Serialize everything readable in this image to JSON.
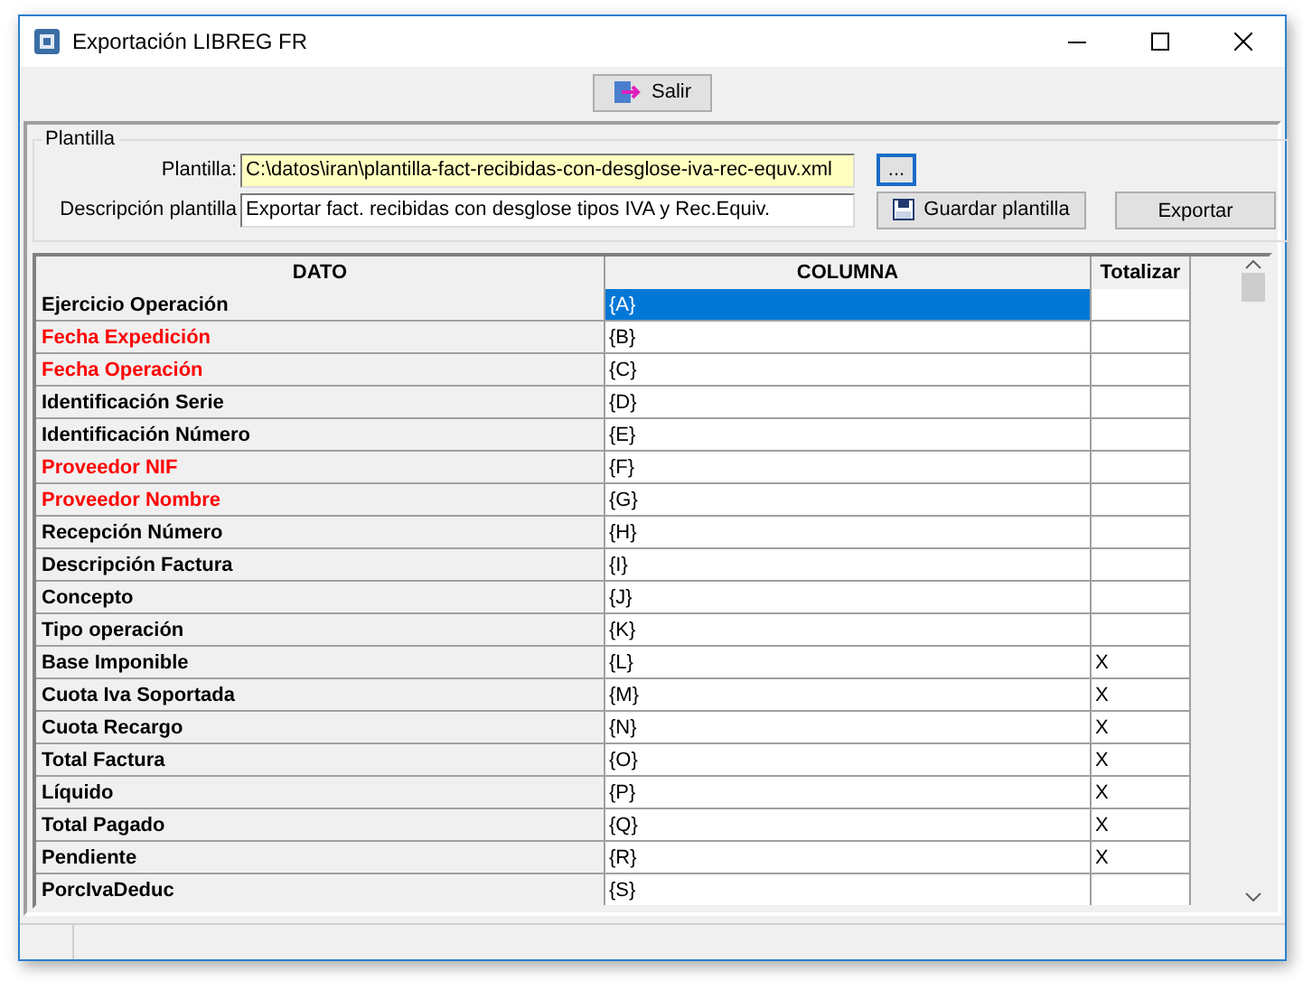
{
  "window": {
    "title": "Exportación LIBREG FR"
  },
  "toolbar": {
    "exit_button": "Salir"
  },
  "group": {
    "title": "Plantilla",
    "template_label": "Plantilla:",
    "template_value": "C:\\datos\\iran\\plantilla-fact-recibidas-con-desglose-iva-rec-equv.xml",
    "browse_button": "...",
    "description_label": "Descripción plantilla",
    "description_value": "Exportar fact. recibidas con desglose tipos IVA y Rec.Equiv.",
    "save_button": "Guardar plantilla",
    "export_button": "Exportar"
  },
  "table": {
    "columns": [
      "DATO",
      "COLUMNA",
      "Totalizar"
    ],
    "rows": [
      {
        "dato": "Ejercicio Operación",
        "columna": "{A}",
        "required": false,
        "selected": true
      },
      {
        "dato": "Fecha Expedición",
        "columna": "{B}",
        "required": true,
        "selected": false
      },
      {
        "dato": "Fecha Operación",
        "columna": "{C}",
        "required": true,
        "selected": false
      },
      {
        "dato": "Identificación Serie",
        "columna": "{D}",
        "required": false,
        "selected": false
      },
      {
        "dato": "Identificación Número",
        "columna": "{E}",
        "required": false,
        "selected": false
      },
      {
        "dato": "Proveedor NIF",
        "columna": "{F}",
        "required": true,
        "selected": false
      },
      {
        "dato": "Proveedor Nombre",
        "columna": "{G}",
        "required": true,
        "selected": false
      },
      {
        "dato": "Recepción Número",
        "columna": "{H}",
        "required": false,
        "selected": false
      },
      {
        "dato": "Descripción Factura",
        "columna": "{I}",
        "required": false,
        "selected": false
      },
      {
        "dato": "Concepto",
        "columna": "{J}",
        "required": false,
        "selected": false
      },
      {
        "dato": "Tipo operación",
        "columna": "{K}",
        "required": false,
        "selected": false
      },
      {
        "dato": "Base Imponible",
        "columna": "{L}",
        "totalizar": "X",
        "required": false,
        "selected": false
      },
      {
        "dato": "Cuota Iva Soportada",
        "columna": "{M}",
        "totalizar": "X",
        "required": false,
        "selected": false
      },
      {
        "dato": "Cuota Recargo",
        "columna": "{N}",
        "totalizar": "X",
        "required": false,
        "selected": false
      },
      {
        "dato": "Total Factura",
        "columna": "{O}",
        "totalizar": "X",
        "required": false,
        "selected": false
      },
      {
        "dato": "Líquido",
        "columna": "{P}",
        "totalizar": "X",
        "required": false,
        "selected": false
      },
      {
        "dato": "Total Pagado",
        "columna": "{Q}",
        "totalizar": "X",
        "required": false,
        "selected": false
      },
      {
        "dato": "Pendiente",
        "columna": "{R}",
        "totalizar": "X",
        "required": false,
        "selected": false
      },
      {
        "dato": "PorcIvaDeduc",
        "columna": "{S}",
        "required": false,
        "selected": false
      }
    ]
  }
}
